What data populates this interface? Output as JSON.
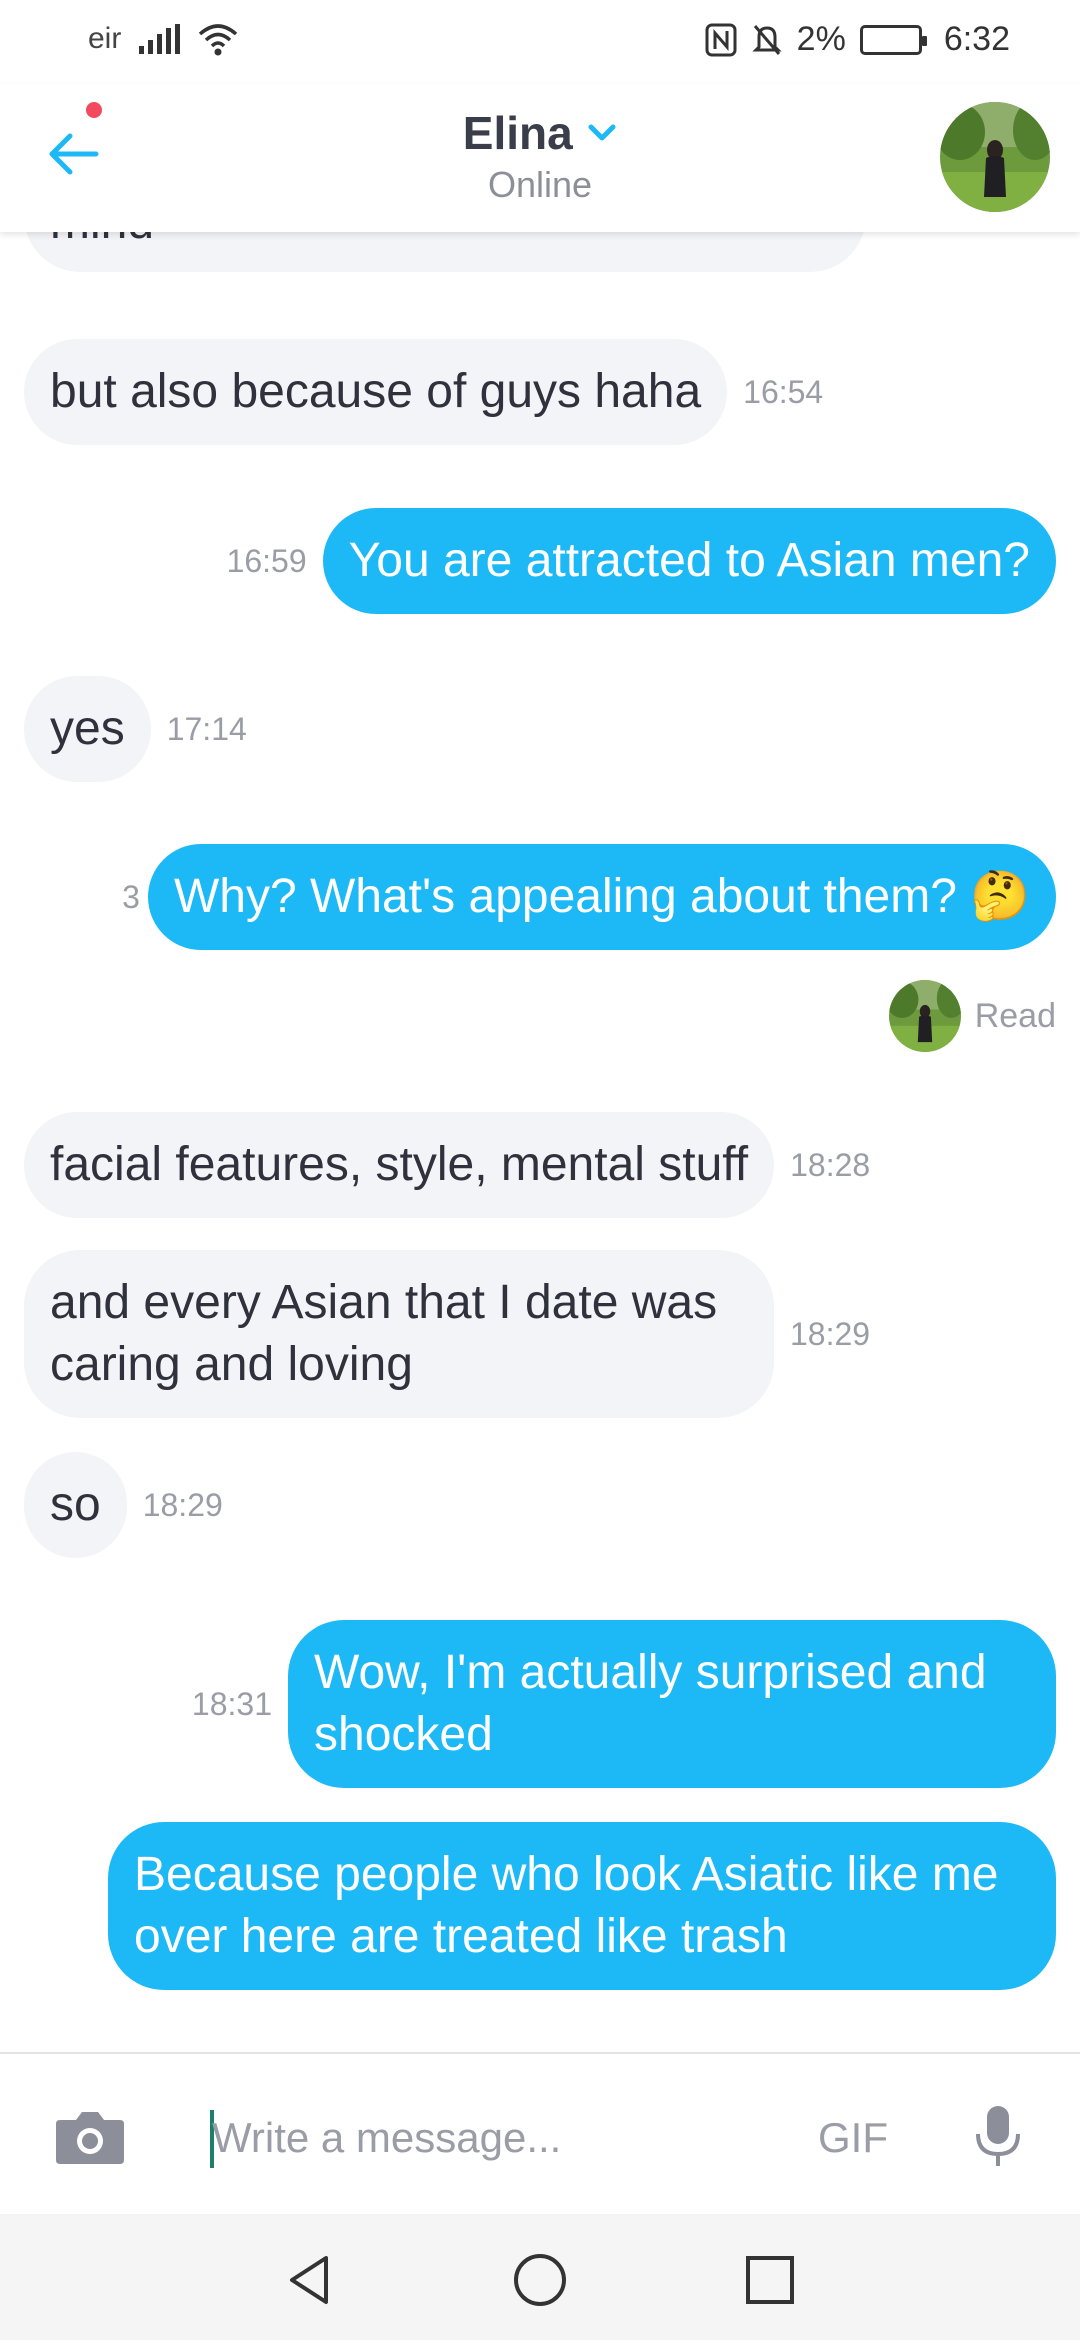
{
  "status_bar": {
    "carrier": "eir",
    "battery_percent": "2%",
    "time": "6:32"
  },
  "header": {
    "contact_name": "Elina",
    "contact_status": "Online",
    "has_notification": true
  },
  "messages": [
    {
      "dir": "in",
      "text": "mind",
      "time": ""
    },
    {
      "dir": "in",
      "text": "but also because of guys haha",
      "time": "16:54"
    },
    {
      "dir": "out",
      "text": "You are attracted to Asian men?",
      "time": "16:59"
    },
    {
      "dir": "in",
      "text": "yes",
      "time": "17:14"
    },
    {
      "dir": "out",
      "text": "Why? What's appealing about them? 🤔",
      "time": "3"
    },
    {
      "dir": "in",
      "text": "facial features, style, mental stuff",
      "time": "18:28"
    },
    {
      "dir": "in",
      "text": "and every Asian that I date was caring and loving",
      "time": "18:29"
    },
    {
      "dir": "in",
      "text": "so",
      "time": "18:29"
    },
    {
      "dir": "out",
      "text": "Wow, I'm actually surprised and shocked",
      "time": "18:31"
    },
    {
      "dir": "out",
      "text": "Because people who look Asiatic like me over here are treated like trash",
      "time": ""
    }
  ],
  "read_receipt": "Read",
  "composer": {
    "placeholder": "Write a message...",
    "gif_label": "GIF"
  },
  "colors": {
    "accent": "#1db9f7",
    "incoming_bubble": "#f3f4f7",
    "notification": "#f2495e"
  },
  "icons": [
    "back-arrow-icon",
    "chevron-down-icon",
    "camera-icon",
    "microphone-icon",
    "nav-back-icon",
    "nav-home-icon",
    "nav-recents-icon"
  ]
}
